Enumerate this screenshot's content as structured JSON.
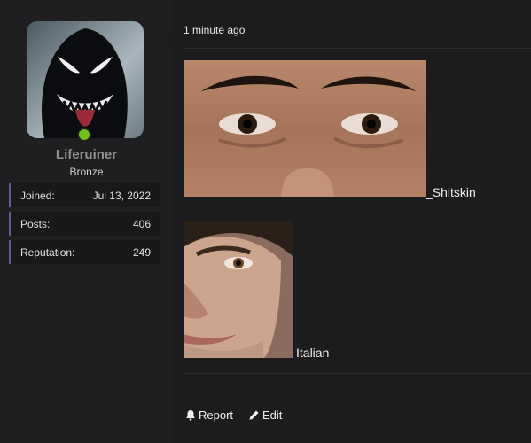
{
  "user": {
    "name": "Liferuiner",
    "title": "Bronze",
    "stats": [
      {
        "label": "Joined:",
        "value": "Jul 13, 2022"
      },
      {
        "label": "Posts:",
        "value": "406"
      },
      {
        "label": "Reputation:",
        "value": "249"
      }
    ],
    "online_color": "#6ec21b"
  },
  "post": {
    "timestamp": "1 minute ago",
    "caption_1": "_Shitskin",
    "caption_2": "Italian"
  },
  "actions": {
    "report": "Report",
    "edit": "Edit"
  },
  "icons": {
    "report": "bell-icon",
    "edit": "pencil-icon"
  }
}
